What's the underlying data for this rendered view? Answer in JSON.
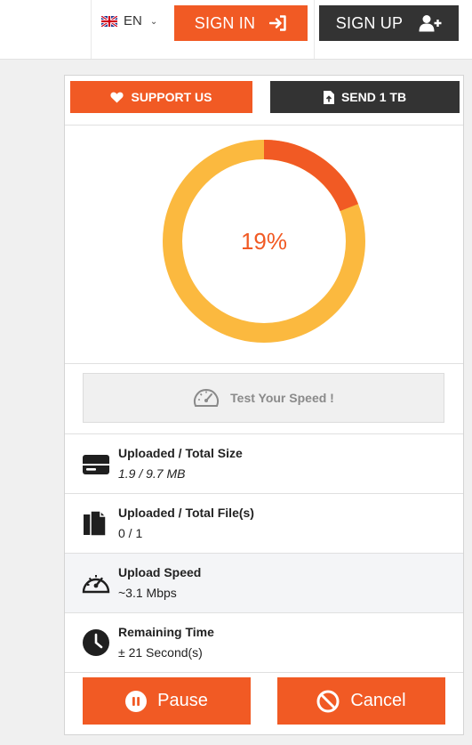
{
  "header": {
    "language": {
      "code": "EN",
      "flag": "uk-flag-icon"
    },
    "sign_in_label": "SIGN IN",
    "sign_up_label": "SIGN UP"
  },
  "panel": {
    "support_label": "SUPPORT US",
    "send_label": "SEND 1 TB",
    "progress": {
      "percent": 19,
      "label": "19%"
    },
    "speed_test_label": "Test Your Speed !",
    "stats": [
      {
        "label": "Uploaded / Total Size",
        "value": "1.9 / 9.7 MB",
        "icon": "drive-icon"
      },
      {
        "label": "Uploaded / Total File(s)",
        "value": "0 / 1",
        "icon": "files-icon"
      },
      {
        "label": "Upload Speed",
        "value": "~3.1 Mbps",
        "icon": "speedometer-icon"
      },
      {
        "label": "Remaining Time",
        "value": "± 21 Second(s)",
        "icon": "clock-icon"
      }
    ],
    "pause_label": "Pause",
    "cancel_label": "Cancel"
  },
  "colors": {
    "accent": "#f15a24",
    "dark": "#333333",
    "ring_track": "#fbb93f"
  }
}
